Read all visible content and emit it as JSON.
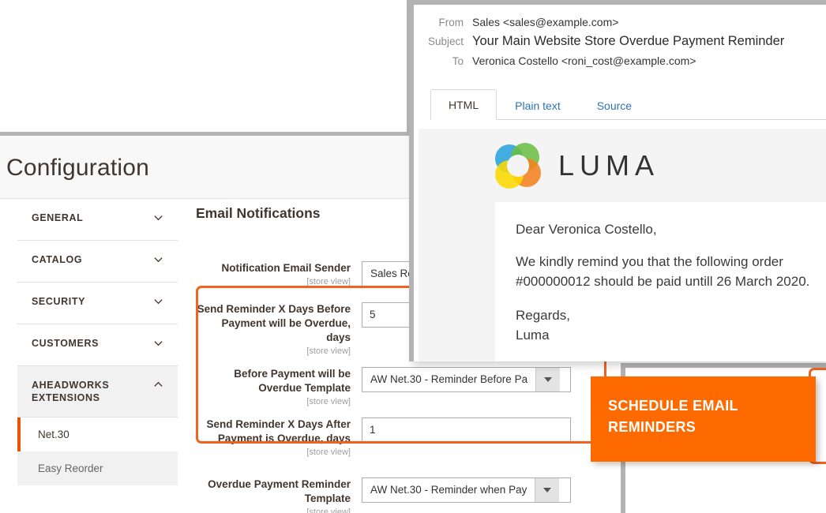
{
  "background_card": {
    "present": true
  },
  "admin": {
    "title": "Configuration",
    "sidebar": {
      "sections": [
        {
          "label": "GENERAL",
          "icon": "chevron-down-icon",
          "expanded": false
        },
        {
          "label": "CATALOG",
          "icon": "chevron-down-icon",
          "expanded": false
        },
        {
          "label": "SECURITY",
          "icon": "chevron-down-icon",
          "expanded": false
        },
        {
          "label": "CUSTOMERS",
          "icon": "chevron-down-icon",
          "expanded": false
        },
        {
          "label": "AHEADWORKS EXTENSIONS",
          "icon": "chevron-up-icon",
          "expanded": true
        }
      ],
      "subitems": [
        {
          "label": "Net.30",
          "active": true
        },
        {
          "label": "Easy Reorder",
          "active": false
        }
      ]
    },
    "form": {
      "section_title": "Email Notifications",
      "scope_note": "[store view]",
      "fields": [
        {
          "label": "Notification Email Sender",
          "scope": "[store view]",
          "type": "select",
          "value": "Sales Re",
          "arrow_icon": "chevron-down-icon"
        },
        {
          "label": "Send Reminder X Days Before Payment will be Overdue, days",
          "scope": "[store view]",
          "type": "text",
          "value": "5"
        },
        {
          "label": "Before Payment will be Overdue Template",
          "scope": "[store view]",
          "type": "select",
          "value": "AW Net.30 - Reminder Before Pa",
          "arrow_icon": "chevron-down-icon"
        },
        {
          "label": "Send Reminder X Days After Payment is Overdue, days",
          "scope": "[store view]",
          "type": "text",
          "value": "1"
        },
        {
          "label": "Overdue Payment Reminder Template",
          "scope": "[store view]",
          "type": "select",
          "value": "AW Net.30 - Reminder when Pay",
          "arrow_icon": "chevron-down-icon"
        }
      ]
    }
  },
  "badge": {
    "line1": "SCHEDULE EMAIL",
    "line2": "REMINDERS",
    "text": "SCHEDULE EMAIL REMINDERS"
  },
  "email_preview": {
    "headers": [
      {
        "label": "From",
        "value": "Sales <sales@example.com>"
      },
      {
        "label": "Subject",
        "value": "Your Main Website Store Overdue Payment Reminder"
      },
      {
        "label": "To",
        "value": "Veronica Costello <roni_cost@example.com>"
      }
    ],
    "tabs": [
      {
        "label": "HTML",
        "active": true
      },
      {
        "label": "Plain text",
        "active": false
      },
      {
        "label": "Source",
        "active": false
      }
    ],
    "logo": {
      "text": "LUMA",
      "mark": "luma-rings-icon"
    },
    "body": {
      "greeting": "Dear Veronica Costello,",
      "paragraph": "We kindly remind you that the following order #000000012 should be paid untill 26 March 2020.",
      "signoff_line1": "Regards,",
      "signoff_line2": "Luma"
    }
  },
  "colors": {
    "accent_orange": "#f26322",
    "badge_orange": "#ff6a00",
    "panel_gray": "#b3b3b3",
    "link_blue": "#2f73b5",
    "text_dark": "#41362f"
  }
}
